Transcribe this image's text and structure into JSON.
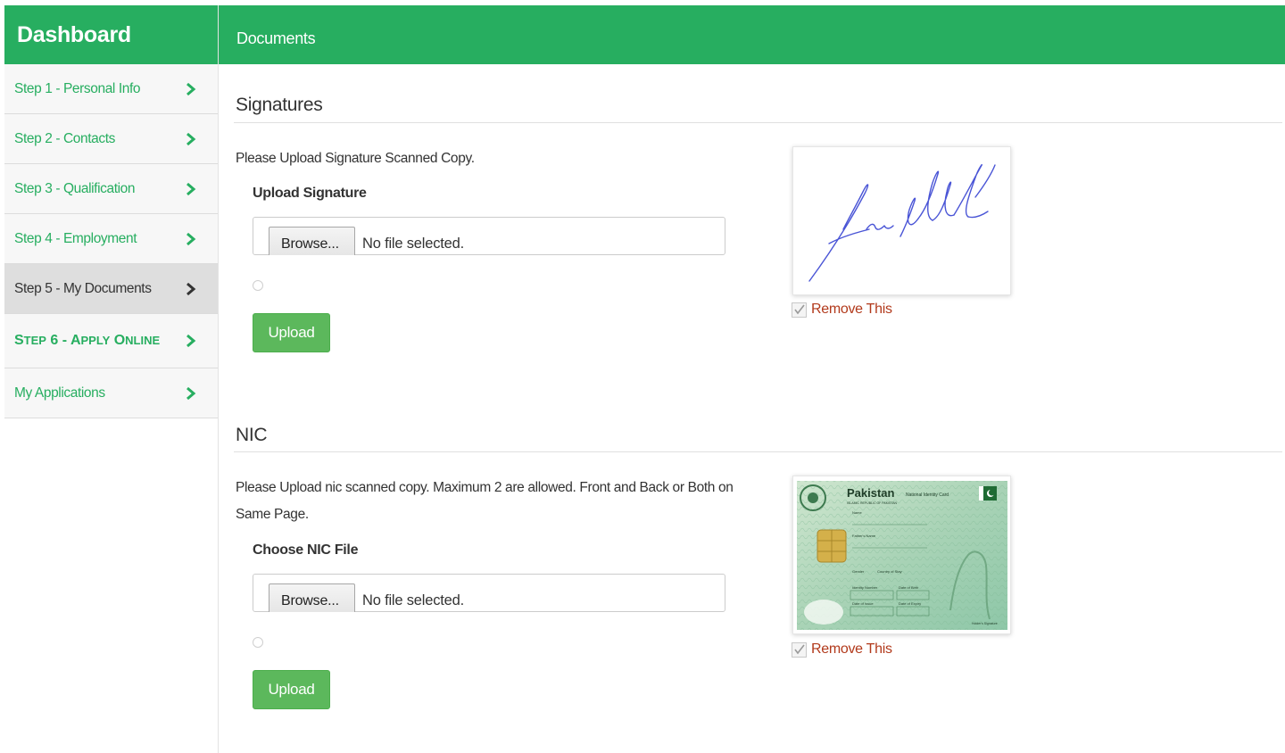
{
  "sidebar": {
    "title": "Dashboard",
    "items": [
      {
        "label": "Step 1 - Personal Info"
      },
      {
        "label": "Step 2 - Contacts"
      },
      {
        "label": "Step 3 - Qualification"
      },
      {
        "label": "Step 4 - Employment"
      },
      {
        "label": "Step 5 - My Documents"
      },
      {
        "label_s": "S",
        "label_rest1": "TEP",
        "label_mid": " 6 - A",
        "label_rest2": "PPLY",
        "label_o": " O",
        "label_rest3": "NLINE"
      },
      {
        "label": "My Applications"
      }
    ]
  },
  "header": {
    "title": "Documents"
  },
  "signatures": {
    "title": "Signatures",
    "description": "Please Upload Signature Scanned Copy.",
    "field_label": "Upload Signature",
    "browse_label": "Browse...",
    "file_status": "No file selected.",
    "upload_label": "Upload",
    "remove_label": "Remove This"
  },
  "nic": {
    "title": "NIC",
    "description": "Please Upload nic scanned copy. Maximum 2 are allowed. Front and Back or Both on Same Page.",
    "field_label": "Choose NIC File",
    "browse_label": "Browse...",
    "file_status": "No file selected.",
    "upload_label": "Upload",
    "remove_label": "Remove This",
    "card": {
      "country": "Pakistan",
      "card_type": "National Identity Card",
      "republic": "ISLAMIC REPUBLIC OF PAKISTAN",
      "fields": [
        "Name",
        "Father's Name",
        "Gender",
        "Country of Stay",
        "Identity Number",
        "Date of Birth",
        "Date of Issue",
        "Date of Expiry",
        "Holder's Signature"
      ]
    }
  },
  "colors": {
    "brand_green": "#27ae60",
    "button_green": "#5cb85c",
    "remove_red": "#b23a1c",
    "signature_ink": "#4a55d6"
  }
}
